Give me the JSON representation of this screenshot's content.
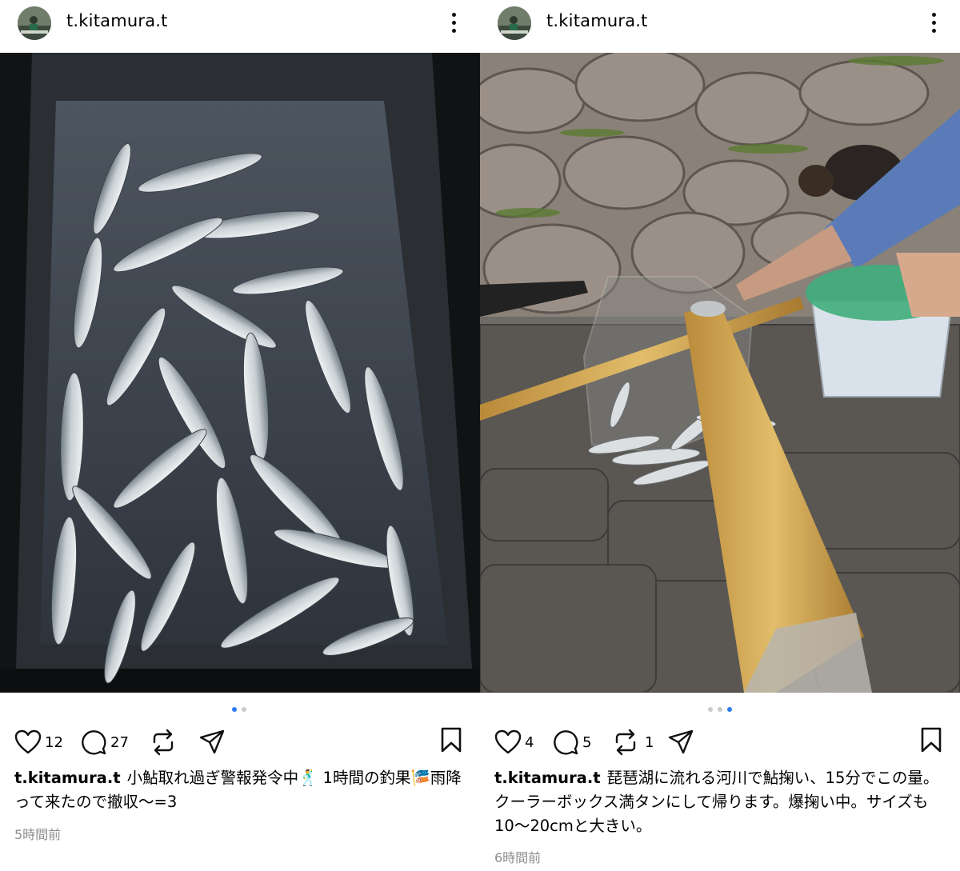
{
  "posts": [
    {
      "username": "t.kitamura.t",
      "likes": "12",
      "comments": "27",
      "reposts": "",
      "caption": "小鮎取れ過ぎ警報発令中🕺 1時間の釣果🎏雨降って来たので撤収〜=3",
      "time": "5時間前",
      "carousel": {
        "count": 2,
        "active": 1
      }
    },
    {
      "username": "t.kitamura.t",
      "likes": "4",
      "comments": "5",
      "reposts": "1",
      "caption": "琵琶湖に流れる河川で鮎掬い、15分でこの量。クーラーボックス満タンにして帰ります。爆掬い中。サイズも10〜20cmと大きい。",
      "time": "6時間前",
      "carousel": {
        "count": 3,
        "active": 3
      }
    }
  ],
  "icons": {
    "like": "heart-outline-icon",
    "comment": "speech-bubble-icon",
    "repost": "repost-arrows-icon",
    "share": "paper-plane-icon",
    "save": "bookmark-outline-icon",
    "more": "vertical-dots-icon"
  },
  "colors": {
    "carousel_active": "#2d7bf0",
    "carousel_inactive": "#c9c9c9",
    "timestamp": "#8e8e8e"
  }
}
